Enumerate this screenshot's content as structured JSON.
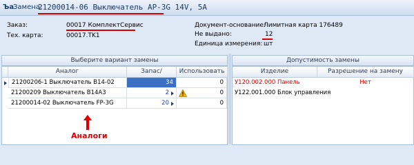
{
  "window": {
    "app_icon": "Ъа",
    "title_prefix": "Замена:",
    "title_main": "21200014-06 Выключатель AP-3G 14V, 5A"
  },
  "info": {
    "order_label": "Заказ:",
    "order_value": "00017 КомплектСервис",
    "techcard_label": "Тех. карта:",
    "techcard_value": "00017.TK1",
    "basis_label": "Документ-основание:",
    "basis_value": "Лимитная карта 176489",
    "not_issued_label": "Не выдано:",
    "not_issued_value": "12",
    "unit_label": "Единица измерения:",
    "unit_value": "шт"
  },
  "left_panel": {
    "header": "Выберите вариант замены",
    "columns": [
      "Аналог",
      "Запас/Дефицит",
      "Использовать"
    ],
    "rows": [
      {
        "analog": "21200206-1 Выключатель B14-02",
        "stock": "34",
        "use": "0",
        "selected": true
      },
      {
        "analog": "21200209 Выключатель B14A3",
        "stock": "2",
        "use": "0",
        "warning": true
      },
      {
        "analog": "21200014-02 Выключатель FP-3G",
        "stock": "20",
        "use": "0"
      }
    ],
    "annotation": "Аналоги"
  },
  "right_panel": {
    "header": "Допустимость замены",
    "columns": [
      "Изделие",
      "Разрешение на замену"
    ],
    "rows": [
      {
        "product": "У120.002.000 Панель",
        "permission": "Нет",
        "highlight": true
      },
      {
        "product": "У122.001.000 Блок управления",
        "permission": ""
      }
    ]
  },
  "colors": {
    "accent_red": "#e00000",
    "selection_blue": "#3a6fc4"
  }
}
